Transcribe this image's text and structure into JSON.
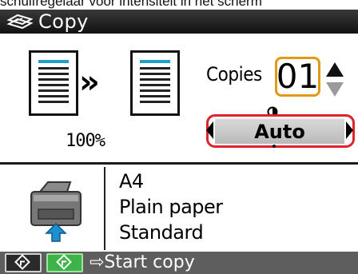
{
  "caption": "schuifregelaar voor intensiteit in het scherm",
  "screen": {
    "title": "Copy",
    "title_icon": "copy-icon",
    "scale": "100%",
    "copies": {
      "label": "Copies",
      "value": "01"
    },
    "intensity": {
      "icon": "intensity-icon",
      "value": "Auto"
    },
    "paper": {
      "size": "A4",
      "type": "Plain paper",
      "quality": "Standard"
    },
    "footer": {
      "black_button_icon": "start-icon",
      "color_button_icon": "start-icon",
      "hint": "⇨Start copy"
    },
    "colors": {
      "copies_highlight": "#e09a18",
      "intensity_highlight": "#e0232a",
      "color_start": "#3cb44a"
    }
  }
}
